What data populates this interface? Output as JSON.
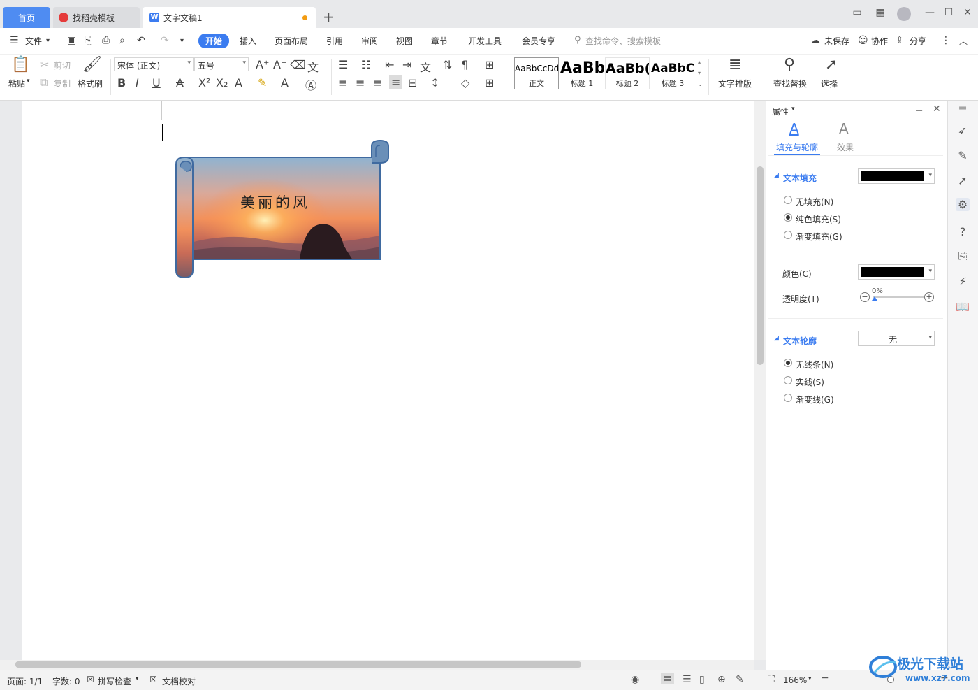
{
  "tabs": {
    "home": "首页",
    "template": "找稻壳模板",
    "document": "文字文稿1"
  },
  "menu": {
    "file": "文件",
    "items": [
      "开始",
      "插入",
      "页面布局",
      "引用",
      "审阅",
      "视图",
      "章节",
      "开发工具",
      "会员专享"
    ],
    "search_placeholder": "查找命令、搜索模板",
    "unsaved": "未保存",
    "collaborate": "协作",
    "share": "分享"
  },
  "ribbon": {
    "paste": "粘贴",
    "cut": "剪切",
    "copy": "复制",
    "format_painter": "格式刷",
    "font_name": "宋体 (正文)",
    "font_size": "五号",
    "styles": [
      {
        "sample": "AaBbCcDd",
        "name": "正文"
      },
      {
        "sample": "AaBb",
        "name": "标题 1"
      },
      {
        "sample": "AaBb(",
        "name": "标题 2"
      },
      {
        "sample": "AaBbC(",
        "name": "标题 3"
      }
    ],
    "text_layout": "文字排版",
    "find_replace": "查找替换",
    "select": "选择"
  },
  "document": {
    "scroll_text": "美丽的风"
  },
  "panel": {
    "title": "属性",
    "tab_fill": "填充与轮廓",
    "tab_effect": "效果",
    "text_fill": "文本填充",
    "fill_options": [
      "无填充(N)",
      "纯色填充(S)",
      "渐变填充(G)"
    ],
    "fill_selected": 1,
    "color_label": "颜色(C)",
    "transparency_label": "透明度(T)",
    "transparency_value": "0%",
    "text_outline": "文本轮廓",
    "outline_value": "无",
    "outline_options": [
      "无线条(N)",
      "实线(S)",
      "渐变线(G)"
    ],
    "outline_selected": 0,
    "fill_color": "#000000"
  },
  "statusbar": {
    "page": "页面: 1/1",
    "words": "字数: 0",
    "spellcheck": "拼写检查",
    "proofread": "文档校对",
    "zoom": "166%"
  },
  "watermark": {
    "brand": "极光下载站",
    "url": "www.xz7.com"
  },
  "colors": {
    "accent": "#3b7cf0",
    "home_tab": "#4f8cf2"
  }
}
